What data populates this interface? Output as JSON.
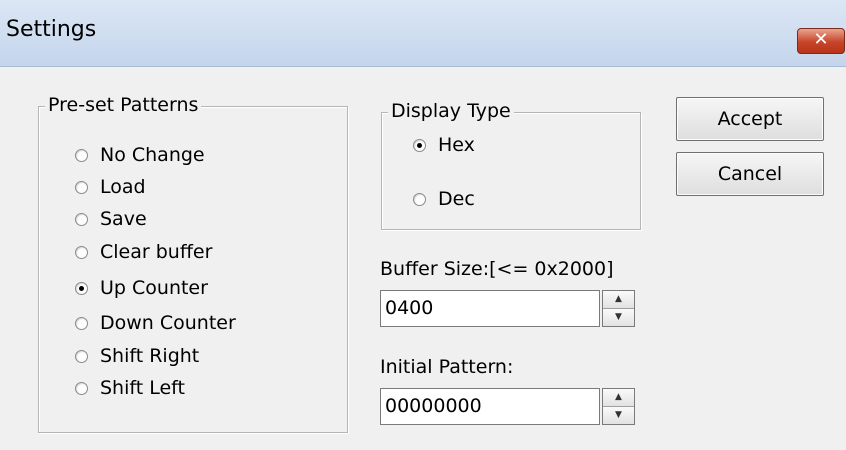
{
  "window": {
    "title": "Settings",
    "close_glyph": "✕"
  },
  "preset_patterns": {
    "legend": "Pre-set Patterns",
    "options": [
      {
        "label": "No Change",
        "checked": false
      },
      {
        "label": "Load",
        "checked": false
      },
      {
        "label": "Save",
        "checked": false
      },
      {
        "label": "Clear buffer",
        "checked": false
      },
      {
        "label": "Up Counter",
        "checked": true
      },
      {
        "label": "Down Counter",
        "checked": false
      },
      {
        "label": "Shift Right",
        "checked": false
      },
      {
        "label": "Shift Left",
        "checked": false
      }
    ]
  },
  "display_type": {
    "legend": "Display Type",
    "options": [
      {
        "label": "Hex",
        "checked": true
      },
      {
        "label": "Dec",
        "checked": false
      }
    ]
  },
  "buffer_size": {
    "label": "Buffer Size:[<= 0x2000]",
    "value": "0400"
  },
  "initial_pattern": {
    "label": "Initial Pattern:",
    "value": "00000000"
  },
  "buttons": {
    "accept": "Accept",
    "cancel": "Cancel"
  },
  "icons": {
    "spin_up": "spin-up-arrow-icon",
    "spin_down": "spin-down-arrow-icon",
    "close": "close-icon"
  },
  "colors": {
    "titlebar": "#c4d5ec",
    "close_button": "#c7442a",
    "dialog_background": "#f0f0f0"
  }
}
